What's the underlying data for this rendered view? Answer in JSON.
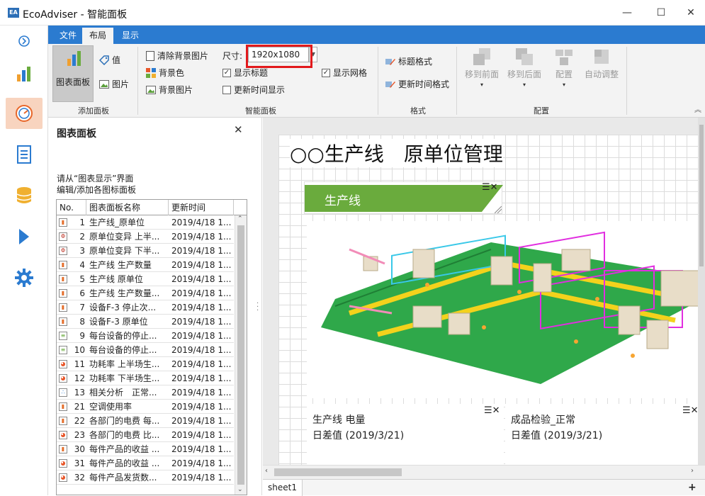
{
  "window": {
    "title": "EcoAdviser - 智能面板",
    "logo_text": "EA",
    "minimize": "—",
    "maximize": "☐",
    "close": "✕"
  },
  "iconbar": {
    "items": [
      {
        "name": "expand-icon"
      },
      {
        "name": "bar-chart-icon"
      },
      {
        "name": "gauge-icon",
        "active": true
      },
      {
        "name": "document-icon"
      },
      {
        "name": "database-icon"
      },
      {
        "name": "play-icon"
      },
      {
        "name": "gear-icon"
      }
    ]
  },
  "ribbon": {
    "tabs": [
      "文件",
      "布局",
      "显示"
    ],
    "selected_tab": "布局",
    "groups": {
      "add_panel": {
        "label": "添加面板",
        "chart_panel": "图表面板",
        "value": "值",
        "image": "图片"
      },
      "smart_panel": {
        "label": "智能面板",
        "clear_bg_image": "清除背景图片",
        "bg_color": "背景色",
        "bg_image": "背景图片",
        "size_label": "尺寸:",
        "size_value": "1920x1080",
        "show_title": "显示标题",
        "show_title_checked": true,
        "update_time_display": "更新时间显示",
        "update_time_checked": false,
        "show_grid": "显示网格",
        "show_grid_checked": true
      },
      "format": {
        "label": "格式",
        "title_format": "标题格式",
        "update_time_format": "更新时间格式"
      },
      "arrange": {
        "label": "配置",
        "bring_front": "移到前面",
        "send_back": "移到后面",
        "arrange": "配置",
        "auto_adjust": "自动调整"
      }
    },
    "collapse_icon": "chevron-up-icon"
  },
  "left_panel": {
    "title": "图表面板",
    "close": "✕",
    "hint_line1": "请从“图表显示”界面",
    "hint_line2": "编辑/添加各图标面板",
    "columns": [
      "No.",
      "图表面板名称",
      "更新时间"
    ],
    "rows": [
      {
        "icon": "bar",
        "no": "1",
        "name": "生产线_原单位",
        "time": "2019/4/18 1..."
      },
      {
        "icon": "box",
        "no": "2",
        "name": "原单位变异 上半...",
        "time": "2019/4/18 1..."
      },
      {
        "icon": "box",
        "no": "3",
        "name": "原单位变异 下半...",
        "time": "2019/4/18 1..."
      },
      {
        "icon": "bar",
        "no": "4",
        "name": "生产线 生产数量",
        "time": "2019/4/18 1..."
      },
      {
        "icon": "bar",
        "no": "5",
        "name": "生产线 原单位",
        "time": "2019/4/18 1..."
      },
      {
        "icon": "bar",
        "no": "6",
        "name": "生产线 生产数量...",
        "time": "2019/4/18 1..."
      },
      {
        "icon": "bar",
        "no": "7",
        "name": "设备F-3 停止次...",
        "time": "2019/4/18 1..."
      },
      {
        "icon": "bar",
        "no": "8",
        "name": "设备F-3 原单位",
        "time": "2019/4/18 1..."
      },
      {
        "icon": "hbar",
        "no": "9",
        "name": "每台设备的停止...",
        "time": "2019/4/18 1..."
      },
      {
        "icon": "hbar",
        "no": "10",
        "name": "每台设备的停止...",
        "time": "2019/4/18 1..."
      },
      {
        "icon": "pie",
        "no": "11",
        "name": "功耗率 上半场生...",
        "time": "2019/4/18 1..."
      },
      {
        "icon": "pie",
        "no": "12",
        "name": "功耗率 下半场生...",
        "time": "2019/4/18 1..."
      },
      {
        "icon": "scatter",
        "no": "13",
        "name": "相关分析　正常...",
        "time": "2019/4/18 1..."
      },
      {
        "icon": "bar",
        "no": "21",
        "name": "空调使用率",
        "time": "2019/4/18 1..."
      },
      {
        "icon": "bar",
        "no": "22",
        "name": "各部门的电费 每...",
        "time": "2019/4/18 1..."
      },
      {
        "icon": "pie",
        "no": "23",
        "name": "各部门的电费 比...",
        "time": "2019/4/18 1..."
      },
      {
        "icon": "bar",
        "no": "30",
        "name": "每件产品的收益 ...",
        "time": "2019/4/18 1..."
      },
      {
        "icon": "pie",
        "no": "31",
        "name": "每件产品的收益 ...",
        "time": "2019/4/18 1..."
      },
      {
        "icon": "pie",
        "no": "32",
        "name": "每件产品发货数...",
        "time": "2019/4/18 1..."
      }
    ]
  },
  "dashboard": {
    "title": "○○生产线　原单位管理",
    "banner_text": "生产线",
    "card_menu": "☰",
    "card_close": "✕",
    "kpi_cards": [
      {
        "title": "生产线 电量",
        "subtitle": "日差值 (2019/3/21)"
      },
      {
        "title": "成品检验_正常",
        "subtitle": "日差值 (2019/3/21)"
      }
    ]
  },
  "sheets": {
    "tabs": [
      "sheet1"
    ],
    "add": "+"
  },
  "colors": {
    "accent_blue": "#2b7bd0",
    "active_icon_bg": "#f8d4bf",
    "banner_green": "#6aab3d",
    "highlight_red": "#e2191c"
  }
}
